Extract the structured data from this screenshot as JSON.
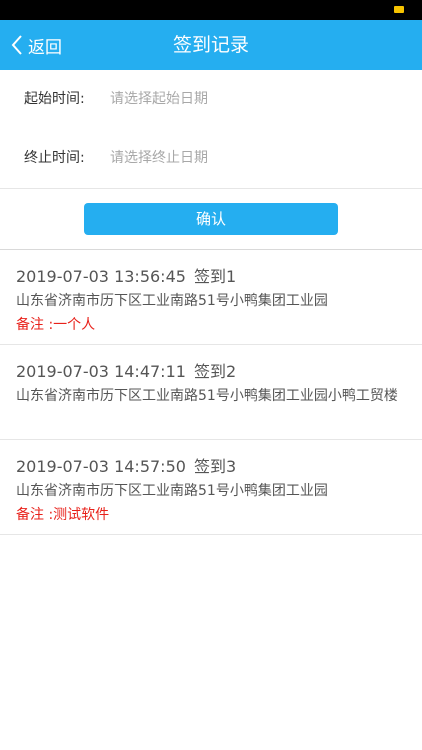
{
  "nav": {
    "back_label": "返回",
    "title": "签到记录"
  },
  "filters": {
    "start_label": "起始时间:",
    "start_placeholder": "请选择起始日期",
    "end_label": "终止时间:",
    "end_placeholder": "请选择终止日期"
  },
  "confirm_label": "确认",
  "records": [
    {
      "datetime": "2019-07-03 13:56:45",
      "title": "签到1",
      "address": "山东省济南市历下区工业南路51号小鸭集团工业园",
      "note": "备注 :一个人"
    },
    {
      "datetime": "2019-07-03 14:47:11",
      "title": "签到2",
      "address": "山东省济南市历下区工业南路51号小鸭集团工业园小鸭工贸楼",
      "note": ""
    },
    {
      "datetime": "2019-07-03 14:57:50",
      "title": "签到3",
      "address": "山东省济南市历下区工业南路51号小鸭集团工业园",
      "note": "备注 :测试软件"
    }
  ],
  "colors": {
    "accent": "#25aef0",
    "note": "#e8221b"
  }
}
